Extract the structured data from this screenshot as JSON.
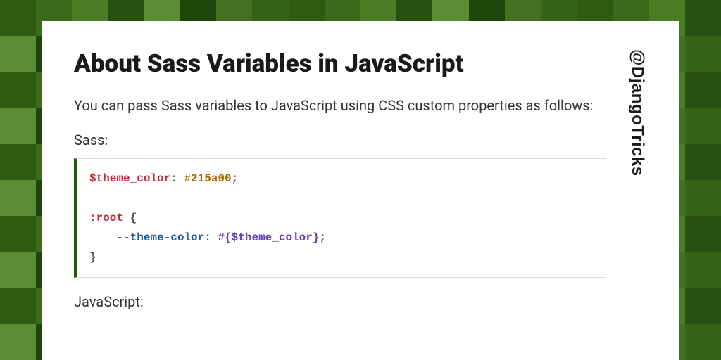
{
  "article": {
    "title": "About Sass Variables in JavaScript",
    "handle": "@DjangoTricks",
    "intro": "You can pass Sass variables to JavaScript using CSS custom properties as follows:",
    "section1_label": "Sass:",
    "section2_label": "JavaScript:"
  },
  "code": {
    "sass": {
      "var_name": "$theme_color",
      "var_value": "#215a00",
      "colon": ":",
      "semicolon": ";",
      "selector": ":root",
      "brace_open": "{",
      "brace_close": "}",
      "indent": "    ",
      "prop_name": "--theme-color",
      "interp_open": "#{",
      "interp_var": "$theme_color",
      "interp_close": "}"
    }
  },
  "colors": {
    "accent": "#215a00"
  }
}
